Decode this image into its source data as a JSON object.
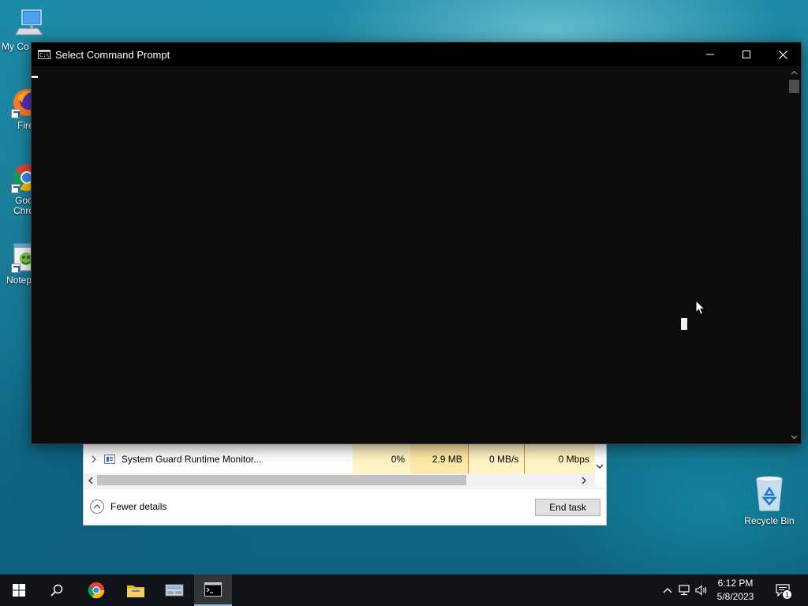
{
  "desktop": {
    "icons": [
      {
        "label": "My Co",
        "icon": "computer-icon"
      },
      {
        "label": "Fire",
        "icon": "firefox-icon"
      },
      {
        "label": "Goo\nChro",
        "line1": "Goo",
        "line2": "Chro",
        "icon": "chrome-icon"
      },
      {
        "label": "Notep",
        "icon": "notepad-icon"
      }
    ],
    "recycle_bin": {
      "label": "Recycle Bin",
      "icon": "recycle-bin-icon"
    }
  },
  "cmd_window": {
    "title": "Select Command Prompt",
    "app_icon_text": "C:\\_",
    "buttons": {
      "minimize": "minimize-icon",
      "maximize": "maximize-icon",
      "close": "close-icon"
    },
    "content": ""
  },
  "task_manager": {
    "process_row": {
      "name": "System Guard Runtime Monitor...",
      "cpu": "0%",
      "memory": "2.9 MB",
      "disk": "0 MB/s",
      "network": "0 Mbps"
    },
    "fewer_details_label": "Fewer details",
    "end_task_label": "End task"
  },
  "taskbar": {
    "pinned": [
      "windows-start-icon",
      "search-icon",
      "chrome-icon",
      "file-explorer-icon",
      "server-manager-icon",
      "command-prompt-icon"
    ],
    "clock_time": "6:12 PM",
    "clock_date": "5/8/2023",
    "notification_count": "1"
  },
  "colors": {
    "cmd_background": "#0c0c0c",
    "taskbar": "#101418",
    "heat_light": "#fff4c4",
    "heat_medium": "#ffe9a6",
    "accent_border": "#d9822b"
  }
}
